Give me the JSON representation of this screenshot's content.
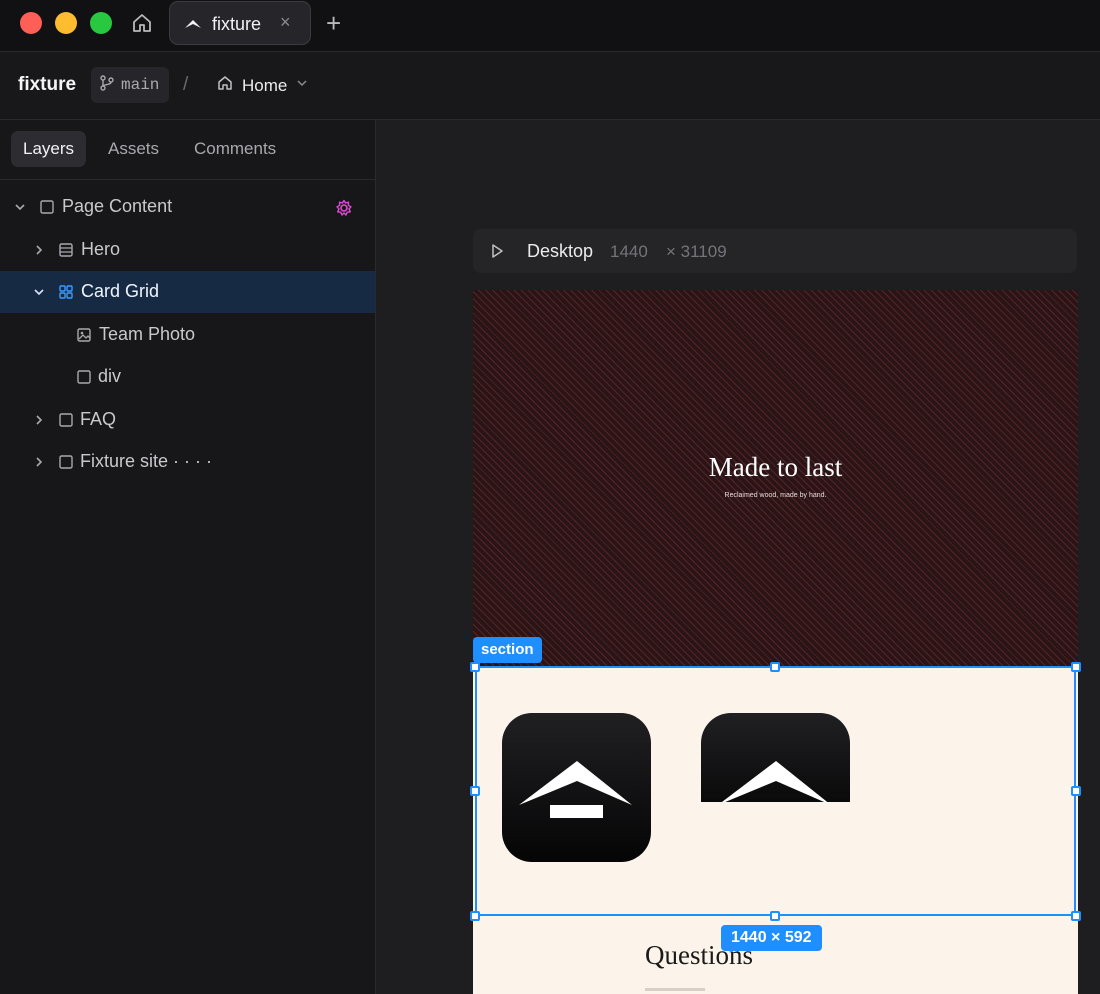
{
  "titlebar": {
    "tab_label": "fixture",
    "close_glyph": "×",
    "new_tab_glyph": "+"
  },
  "toolbar": {
    "project_name": "fixture",
    "branch": "main",
    "separator": "/",
    "page": "Home"
  },
  "sidebar": {
    "tabs": [
      "Layers",
      "Assets",
      "Comments"
    ],
    "active_tab": "Layers",
    "layers": [
      {
        "label": "Page Content",
        "icon": "frame-icon",
        "expanded": true
      },
      {
        "label": "Hero",
        "icon": "section-icon",
        "expanded": false
      },
      {
        "label": "Card Grid",
        "icon": "grid-icon",
        "expanded": true,
        "selected": true
      },
      {
        "label": "Team Photo",
        "icon": "image-icon"
      },
      {
        "label": "div",
        "icon": "frame-icon"
      },
      {
        "label": "FAQ",
        "icon": "frame-icon",
        "expanded": false
      },
      {
        "label": "Fixture site · · · ·",
        "icon": "frame-icon",
        "expanded": false
      }
    ]
  },
  "canvas": {
    "frame_name": "Desktop",
    "frame_width": "1440",
    "frame_height": "× 31109",
    "hero_title": "Made to last",
    "hero_subtitle": "Reclaimed wood, made by hand.",
    "faq_title": "Questions",
    "selection_tag": "section",
    "selection_dims": "1440 × 592"
  },
  "colors": {
    "accent": "#1f8fff",
    "selected_row": "#172a44",
    "hero_bg": "#2a1416",
    "section_bg": "#fcf3eb"
  }
}
